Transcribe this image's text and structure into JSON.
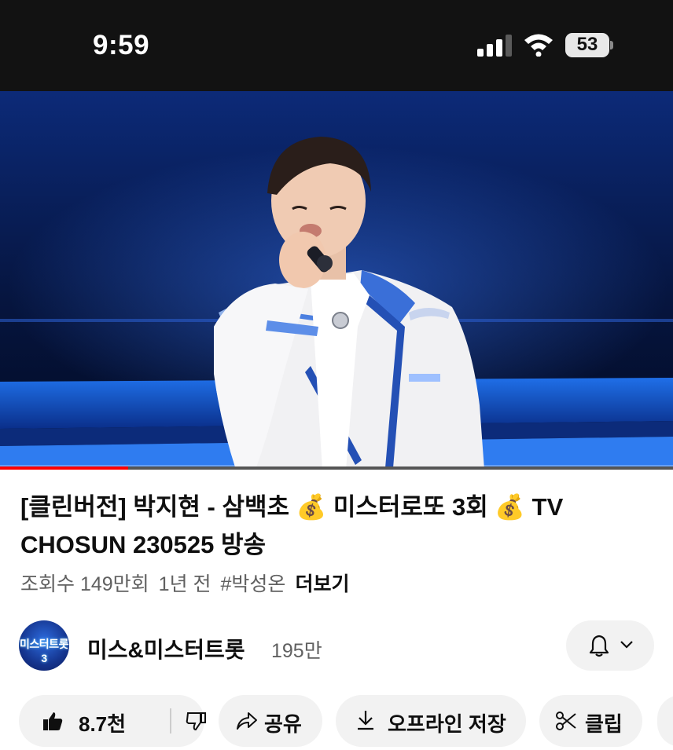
{
  "status_bar": {
    "time": "9:59",
    "battery": "53"
  },
  "video": {
    "progress": 0.19
  },
  "info": {
    "title": "[클린버전] 박지현 - 삼백초 💰 미스터로또 3회 💰 TV CHOSUN 230525 방송",
    "views": "조회수 149만회",
    "age": "1년 전",
    "hashtag": "#박성온",
    "more": "더보기"
  },
  "channel": {
    "avatar_text": "미스터트롯3",
    "name": "미스&미스터트롯",
    "subscribers": "195만",
    "notify_icon": "bell-icon",
    "notify_chevron": "chevron-down-icon"
  },
  "actions": {
    "like_count": "8.7천",
    "share": "공유",
    "download": "오프라인 저장",
    "clip": "클립"
  },
  "colors": {
    "status_bg": "#121212",
    "chip_bg": "#f2f2f2",
    "progress": "#ff0000",
    "meta_text": "#606060"
  }
}
